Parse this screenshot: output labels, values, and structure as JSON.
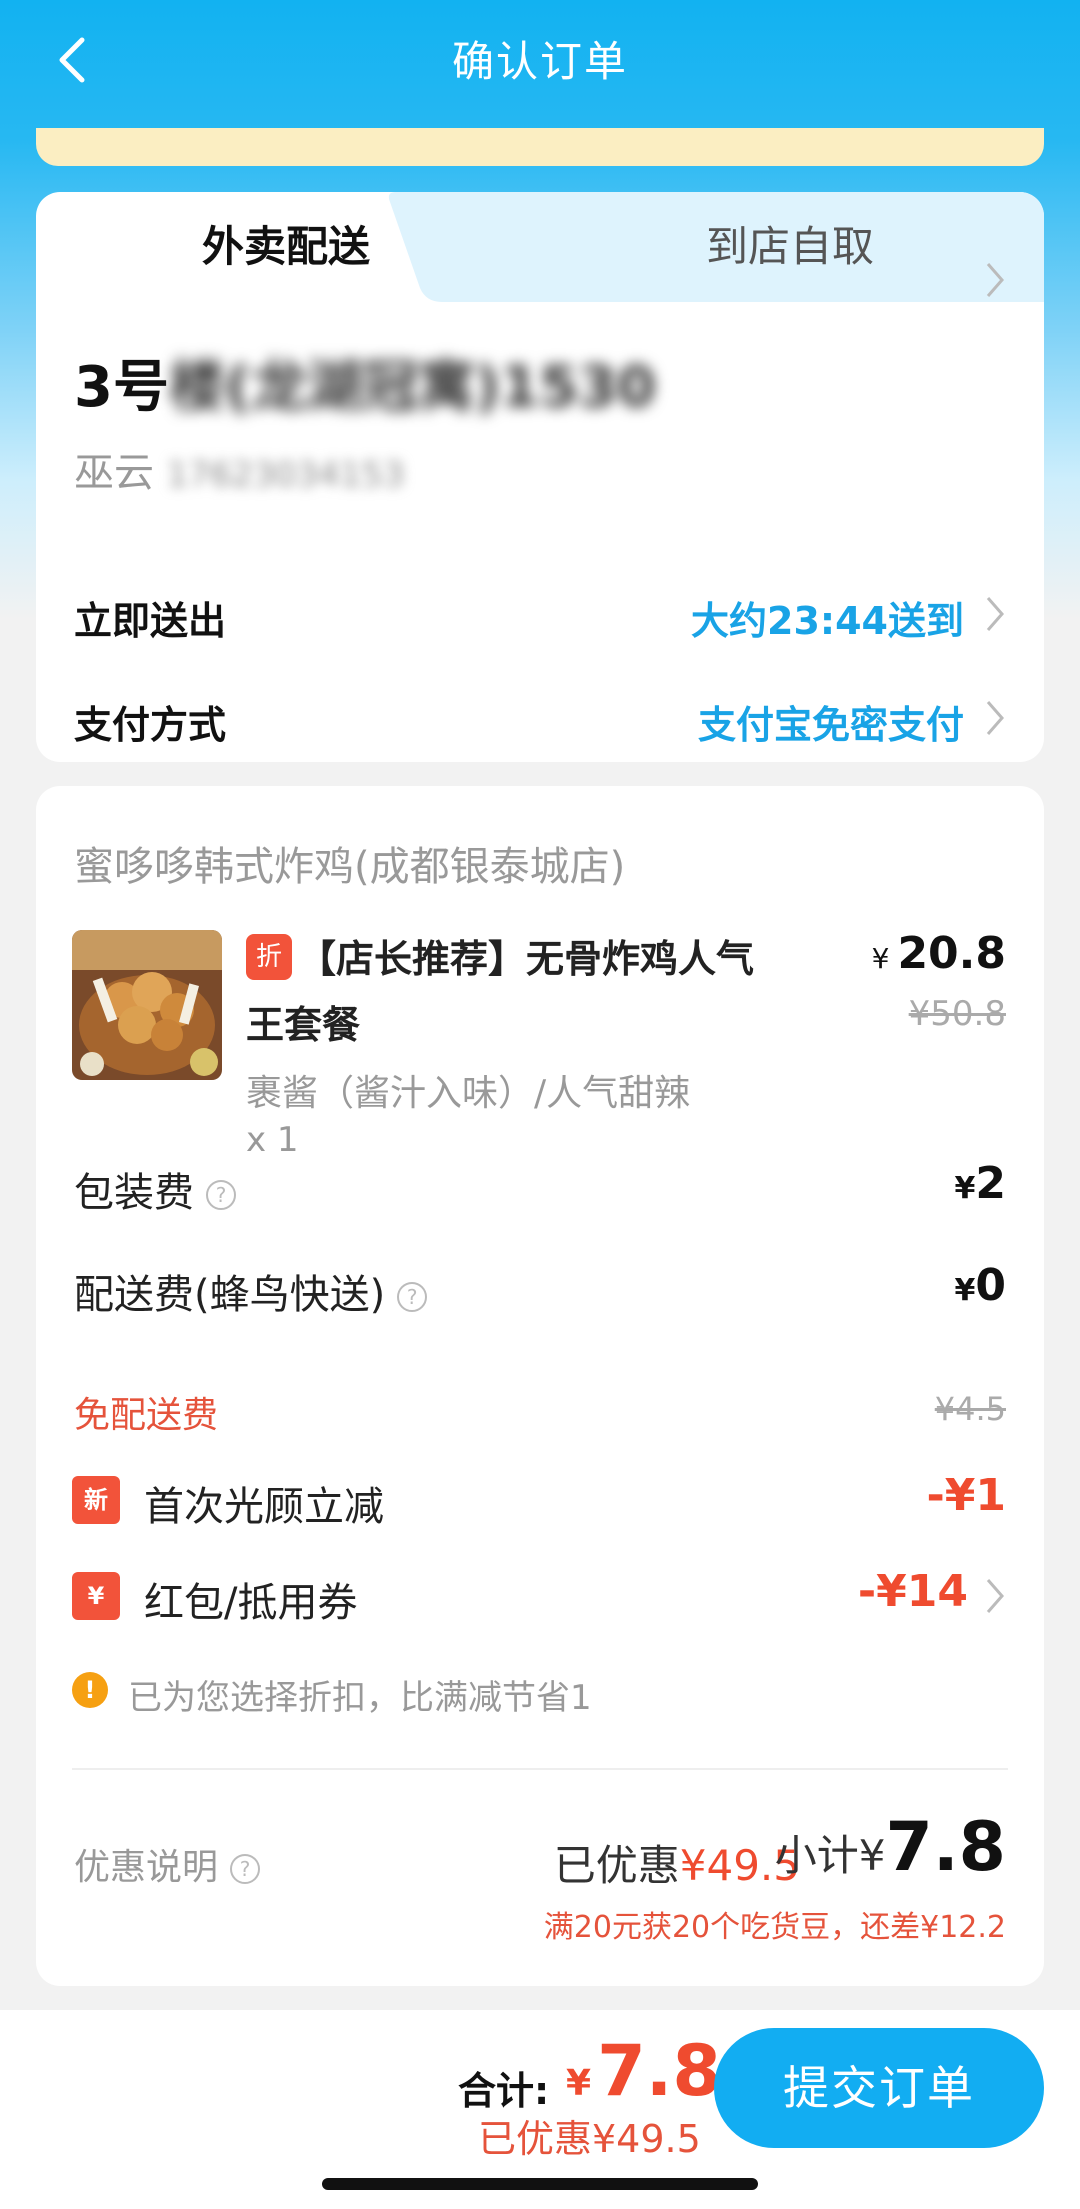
{
  "header": {
    "title": "确认订单"
  },
  "tabs": {
    "delivery": "外卖配送",
    "pickup": "到店自取"
  },
  "address": {
    "prefix": "3号",
    "blurred": "楼(龙湖冠寓)1530",
    "name": "巫云",
    "phone_blurred": "17623034153"
  },
  "delivery_time": {
    "label": "立即送出",
    "value": "大约23:44送到"
  },
  "payment": {
    "label": "支付方式",
    "value": "支付宝免密支付"
  },
  "order": {
    "shop": "蜜哆哆韩式炸鸡(成都银泰城店)",
    "item": {
      "tag": "折",
      "name_line1": "【店长推荐】无骨炸鸡人气",
      "name_line2": "王套餐",
      "spec": "裹酱（酱汁入味）/人气甜辣",
      "qty": "x 1",
      "currency": "¥",
      "price": "20.8",
      "original_price": "¥50.8"
    },
    "packing": {
      "label": "包装费",
      "currency": "¥",
      "value": "2"
    },
    "delivery_fee": {
      "label": "配送费(蜂鸟快送)",
      "currency": "¥",
      "value": "0",
      "free_label": "免配送费",
      "original": "¥4.5"
    },
    "new_customer": {
      "badge": "新",
      "label": "首次光顾立减",
      "value": "-¥1"
    },
    "coupon": {
      "badge": "¥",
      "label": "红包/抵用券",
      "value": "-¥14"
    },
    "tip": {
      "icon": "!",
      "text": "已为您选择折扣，比满减节省1"
    },
    "promo_label": "优惠说明",
    "saved_prefix": "已优惠",
    "saved_value": "¥49.5",
    "subtotal_prefix": "小计¥",
    "subtotal_value": "7.8",
    "bean_note": "满20元获20个吃货豆，还差¥12.2"
  },
  "bottom_bar": {
    "total_label": "合计:",
    "currency": "¥",
    "total_value": "7.8",
    "saved": "已优惠¥49.5",
    "submit": "提交订单"
  },
  "colors": {
    "brand": "#12adf2",
    "accent_red": "#ef4b2f",
    "link_blue": "#19a3e6"
  }
}
